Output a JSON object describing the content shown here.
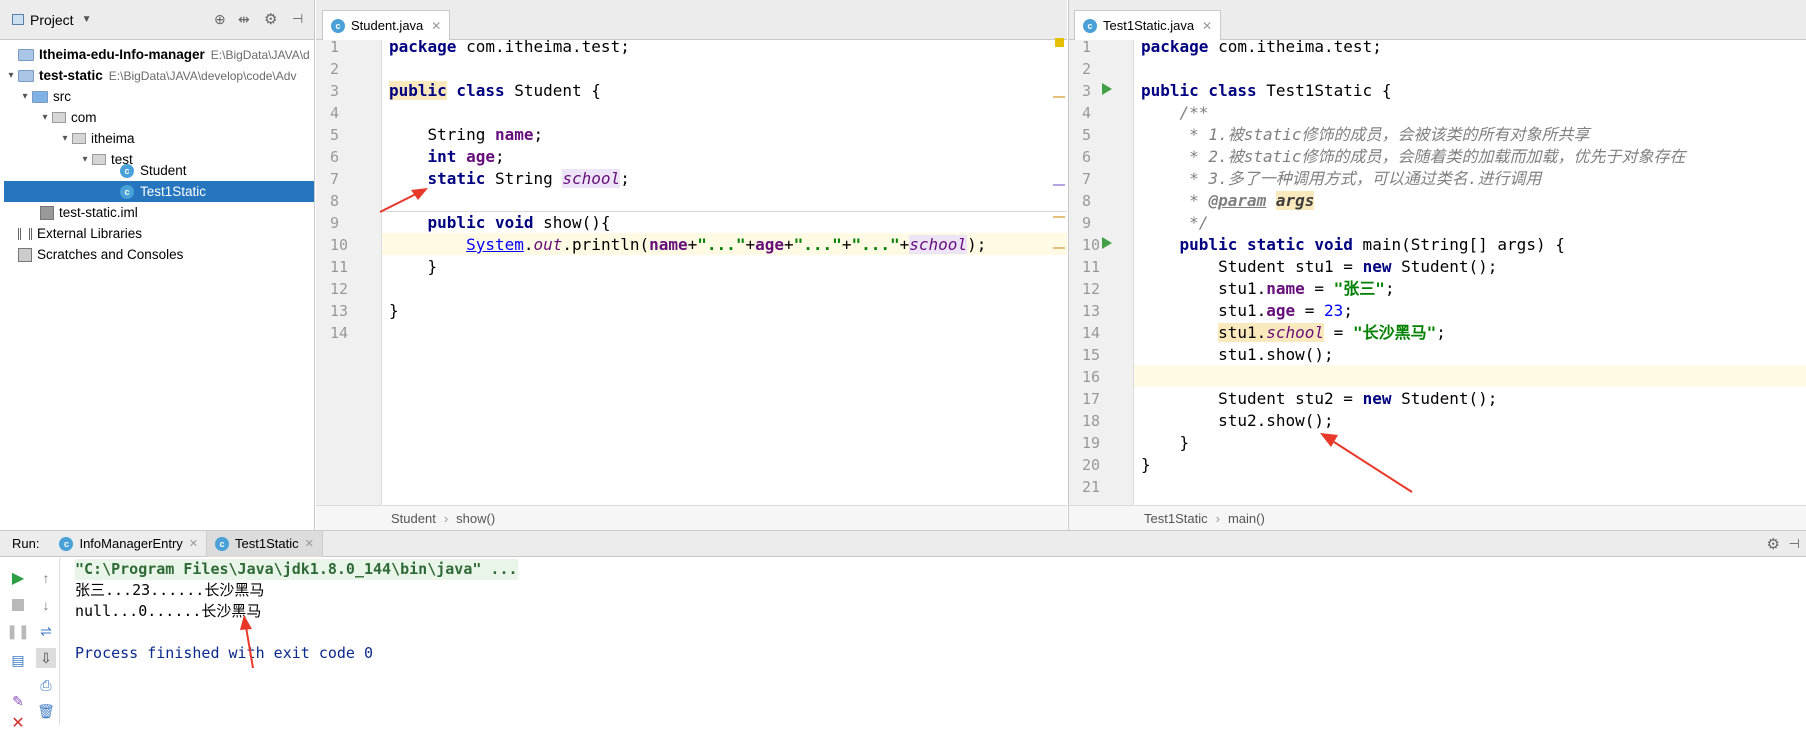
{
  "project_panel": {
    "title": "Project",
    "tree": [
      {
        "label": "Itheima-edu-Info-manager",
        "path": "E:\\BigData\\JAVA\\d"
      },
      {
        "label": "test-static",
        "path": "E:\\BigData\\JAVA\\develop\\code\\Adv"
      },
      {
        "label": "src"
      },
      {
        "label": "com"
      },
      {
        "label": "itheima"
      },
      {
        "label": "test"
      },
      {
        "label": "Student"
      },
      {
        "label": "Test1Static"
      },
      {
        "label": "test-static.iml"
      },
      {
        "label": "External Libraries"
      },
      {
        "label": "Scratches and Consoles"
      }
    ]
  },
  "editor_left": {
    "tab": "Student.java",
    "line_numbers": [
      "1",
      "2",
      "3",
      "4",
      "5",
      "6",
      "7",
      "8",
      "9",
      "10",
      "11",
      "12",
      "13",
      "14"
    ],
    "breadcrumb": [
      "Student",
      "show()"
    ],
    "code": {
      "l1_kw": "package",
      "l1_rest": " com.itheima.test;",
      "l3_kw1": "public",
      "l3_kw2": " class",
      "l3_rest": " Student {",
      "l5_type": "    String ",
      "l5_fld": "name",
      "l5_end": ";",
      "l6_kw": "    int ",
      "l6_fld": "age",
      "l6_end": ";",
      "l7_kw": "    static",
      "l7_type": " String ",
      "l7_fld": "school",
      "l7_end": ";",
      "l9_kw1": "    public",
      "l9_kw2": " void",
      "l9_rest": " show(){",
      "l10_pre": "        ",
      "l10_sys": "System",
      "l10_dot": ".",
      "l10_out": "out",
      "l10_call": ".println(",
      "l10_name": "name",
      "l10_p1": "+",
      "l10_s1": "\"...\"",
      "l10_p2": "+",
      "l10_age": "age",
      "l10_p3": "+",
      "l10_s2": "\"...\"",
      "l10_p4": "+",
      "l10_s3": "\"...\"",
      "l10_p5": "+",
      "l10_sch": "school",
      "l10_end": ");",
      "l11": "    }",
      "l13": "}"
    }
  },
  "editor_right": {
    "tab": "Test1Static.java",
    "line_numbers": [
      "1",
      "2",
      "3",
      "4",
      "5",
      "6",
      "7",
      "8",
      "9",
      "10",
      "11",
      "12",
      "13",
      "14",
      "15",
      "16",
      "17",
      "18",
      "19",
      "20",
      "21"
    ],
    "breadcrumb": [
      "Test1Static",
      "main()"
    ],
    "code": {
      "l1_kw": "package",
      "l1_rest": " com.itheima.test;",
      "l3_kw1": "public",
      "l3_kw2": " class",
      "l3_rest": " Test1Static {",
      "l4": "    /**",
      "l5": "     * 1.被static修饰的成员，会被该类的所有对象所共享",
      "l6": "     * 2.被static修饰的成员，会随着类的加载而加载，优先于对象存在",
      "l7": "     * 3.多了一种调用方式，可以通过类名.进行调用",
      "l8_pre": "     * ",
      "l8_tag": "@param",
      "l8_sp": " ",
      "l8_val": "args",
      "l9": "     */",
      "l10_kw": "    public static void",
      "l10_rest": " main(String[] args) {",
      "l11_a": "        Student stu1 = ",
      "l11_kw": "new",
      "l11_b": " Student();",
      "l12_a": "        stu1.",
      "l12_fld": "name",
      "l12_b": " = ",
      "l12_str": "\"张三\"",
      "l12_end": ";",
      "l13_a": "        stu1.",
      "l13_fld": "age",
      "l13_b": " = ",
      "l13_num": "23",
      "l13_end": ";",
      "l14_pre": "        ",
      "l14_obj": "stu1.",
      "l14_fld": "school",
      "l14_b": " = ",
      "l14_str": "\"长沙黑马\"",
      "l14_end": ";",
      "l15": "        stu1.show();",
      "l17_a": "        Student stu2 = ",
      "l17_kw": "new",
      "l17_b": " Student();",
      "l18": "        stu2.show();",
      "l19": "    }",
      "l20": "}"
    }
  },
  "run_panel": {
    "label": "Run:",
    "tabs": [
      "InfoManagerEntry",
      "Test1Static"
    ],
    "output": [
      "\"C:\\Program Files\\Java\\jdk1.8.0_144\\bin\\java\" ...",
      "张三...23......长沙黑马",
      "null...0......长沙黑马",
      "",
      "Process finished with exit code 0"
    ]
  },
  "colors": {
    "keyword": "#000080",
    "field": "#660e7a",
    "string": "#008000",
    "number": "#0000ff",
    "selection": "#2675bf",
    "arrow": "#e8382a"
  }
}
